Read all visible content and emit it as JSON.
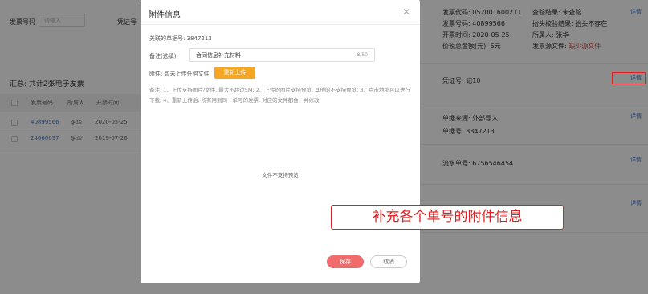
{
  "filters": {
    "invoice_no_label": "发票号码",
    "invoice_no_placeholder": "请输入",
    "voucher_no_label": "凭证号"
  },
  "summary": "汇总: 共计2张电子发票",
  "table": {
    "headers": [
      "发票号码",
      "所属人",
      "开票时间"
    ],
    "rows": [
      {
        "invoice_no": "40899566",
        "owner": "张华",
        "date": "2020-05-25"
      },
      {
        "invoice_no": "24660097",
        "owner": "张华",
        "date": "2019-07-26"
      }
    ]
  },
  "right_panel": {
    "invoice_card": {
      "invoice_code": "发票代码: 052001600211",
      "invoice_number": "发票号码: 40899566",
      "issue_time": "开票时间: 2020-05-25",
      "total_amount": "价税总金额(元): 6元",
      "check_result": "查验结果: 未查验",
      "title_check": "抬头校验结果: 抬头不存在",
      "owner": "所属人: 张华",
      "source_file": "发票源文件: 缺少源文件"
    },
    "voucher": "凭证号: 记10",
    "doc_source": "单据来源: 外部导入",
    "doc_no": "单据号: 3847213",
    "flow_no": "流水单号: 6756546454",
    "detail_link": "详情"
  },
  "modal": {
    "title": "附件信息",
    "related_doc": "关联的单据号: 3847213",
    "remark_label": "备注(选填):",
    "remark_value": "合同信息补充材料",
    "remark_count": "8/50",
    "attachment_label": "附件: 暂未上传任何文件",
    "upload_button": "重新上传",
    "note": "备注: 1、上传支持图片/文件, 最大不超过5M; 2、上传的图片支持预览, 其他的不支持预览; 3、点击地址可以进行下载; 4、重新上传后, 所有用到同一单号的发票, 对应的文件都会一并修改;",
    "preview_text": "文件不支持预览",
    "save_button": "保存",
    "cancel_button": "取消"
  },
  "callout": "补充各个单号的附件信息",
  "colors": {
    "accent_orange": "#f5a623",
    "save_red": "#f06b6b",
    "link_blue": "#3a78d8",
    "highlight_red": "#e02020"
  }
}
